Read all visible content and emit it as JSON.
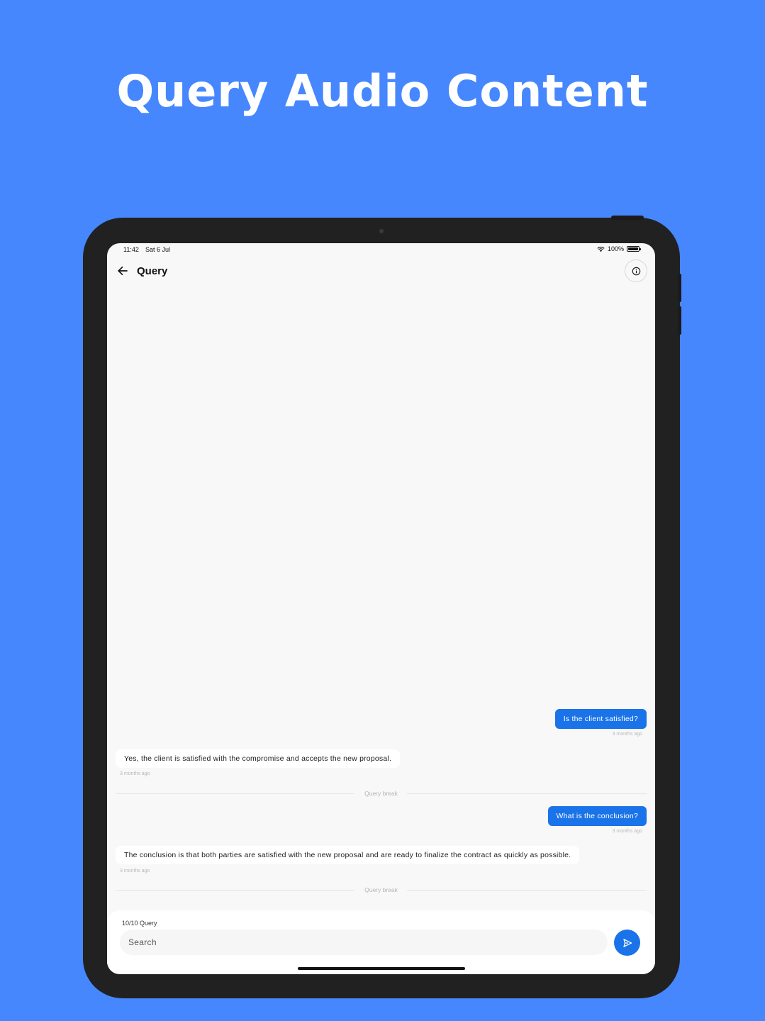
{
  "headline": "Query Audio Content",
  "status_bar": {
    "time": "11:42",
    "date": "Sat 6 Jul",
    "battery": "100%"
  },
  "app_bar": {
    "title": "Query"
  },
  "messages": [
    {
      "role": "user",
      "text": "Is the client satisfied?",
      "time": "3 months ago"
    },
    {
      "role": "bot",
      "text": "Yes, the client is satisfied with the compromise and accepts the new proposal.",
      "time": "3 months ago"
    },
    {
      "role": "divider",
      "text": "Query break"
    },
    {
      "role": "user",
      "text": "What is the conclusion?",
      "time": "3 months ago"
    },
    {
      "role": "bot",
      "text": "The conclusion is that both parties are satisfied with the new proposal and are ready to finalize the contract as quickly as possible.",
      "time": "3 months ago"
    },
    {
      "role": "divider",
      "text": "Query break"
    }
  ],
  "composer": {
    "query_count": "10/10 Query",
    "placeholder": "Search"
  },
  "colors": {
    "background": "#4687FE",
    "accent": "#1A73E8",
    "screen": "#F8F8F8"
  },
  "icons": {
    "back": "arrow-left-icon",
    "info": "info-icon",
    "send": "send-icon",
    "wifi": "wifi-icon",
    "battery": "battery-icon"
  }
}
